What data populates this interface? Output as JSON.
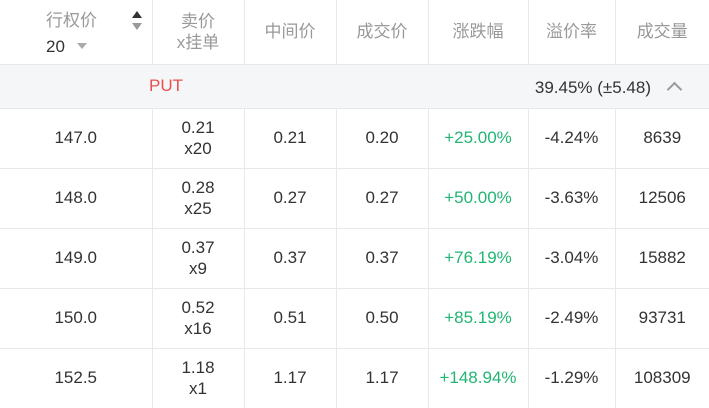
{
  "header": {
    "strike_label": "行权价",
    "strike_selector_value": "20",
    "ask_label_line1": "卖价",
    "ask_label_line2": "x挂单",
    "mid_label": "中间价",
    "last_label": "成交价",
    "change_label": "涨跌幅",
    "premium_label": "溢价率",
    "volume_label": "成交量"
  },
  "section": {
    "type_label": "PUT",
    "iv_label": "39.45% (±5.48)",
    "collapse_icon": "chevron-up-icon"
  },
  "rows": [
    {
      "strike": "147.0",
      "ask": "0.21",
      "ask_size": "x20",
      "mid": "0.21",
      "last": "0.20",
      "change": "+25.00%",
      "premium": "-4.24%",
      "volume": "8639"
    },
    {
      "strike": "148.0",
      "ask": "0.28",
      "ask_size": "x25",
      "mid": "0.27",
      "last": "0.27",
      "change": "+50.00%",
      "premium": "-3.63%",
      "volume": "12506"
    },
    {
      "strike": "149.0",
      "ask": "0.37",
      "ask_size": "x9",
      "mid": "0.37",
      "last": "0.37",
      "change": "+76.19%",
      "premium": "-3.04%",
      "volume": "15882"
    },
    {
      "strike": "150.0",
      "ask": "0.52",
      "ask_size": "x16",
      "mid": "0.51",
      "last": "0.50",
      "change": "+85.19%",
      "premium": "-2.49%",
      "volume": "93731"
    },
    {
      "strike": "152.5",
      "ask": "1.18",
      "ask_size": "x1",
      "mid": "1.17",
      "last": "1.17",
      "change": "+148.94%",
      "premium": "-1.29%",
      "volume": "108309"
    }
  ],
  "colors": {
    "put_label": "#e85151",
    "positive_change": "#22b573",
    "header_text": "#999999",
    "section_bg": "#f5f6f8"
  }
}
